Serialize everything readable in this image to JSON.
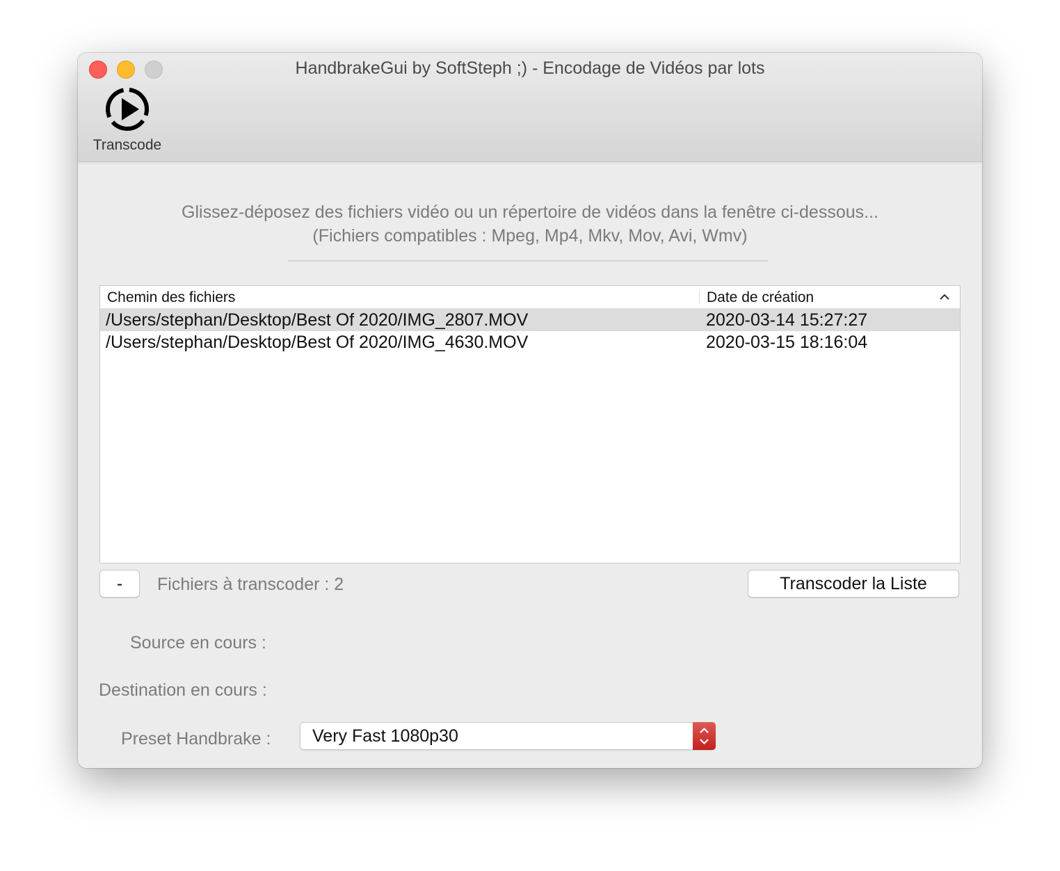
{
  "window": {
    "title": "HandbrakeGui by SoftSteph ;) - Encodage de Vidéos par lots"
  },
  "toolbar": {
    "transcode_label": "Transcode",
    "transcode_icon": "play-circle-icon"
  },
  "hint": {
    "line1": "Glissez-déposez des fichiers vidéo ou un répertoire de vidéos dans la fenêtre ci-dessous...",
    "line2": "(Fichiers compatibles : Mpeg, Mp4, Mkv, Mov, Avi, Wmv)"
  },
  "table": {
    "columns": [
      "Chemin des fichiers",
      "Date de création"
    ],
    "sort": "ascending",
    "rows": [
      {
        "path": "/Users/stephan/Desktop/Best Of 2020/IMG_2807.MOV",
        "date": "2020-03-14 15:27:27",
        "selected": true
      },
      {
        "path": "/Users/stephan/Desktop/Best Of 2020/IMG_4630.MOV",
        "date": "2020-03-15 18:16:04",
        "selected": false
      }
    ]
  },
  "controls": {
    "remove_label": "-",
    "count_label": "Fichiers à transcoder : 2",
    "transcode_list_label": "Transcoder la Liste"
  },
  "status": {
    "source_label": "Source en cours  :",
    "destination_label": "Destination en cours :"
  },
  "preset": {
    "label": "Preset Handbrake :",
    "value": "Very Fast 1080p30"
  },
  "colors": {
    "close": "#fe5f57",
    "minimize": "#febc2e",
    "zoom": "#cfcfcf",
    "stepper": "#cf3b36"
  }
}
